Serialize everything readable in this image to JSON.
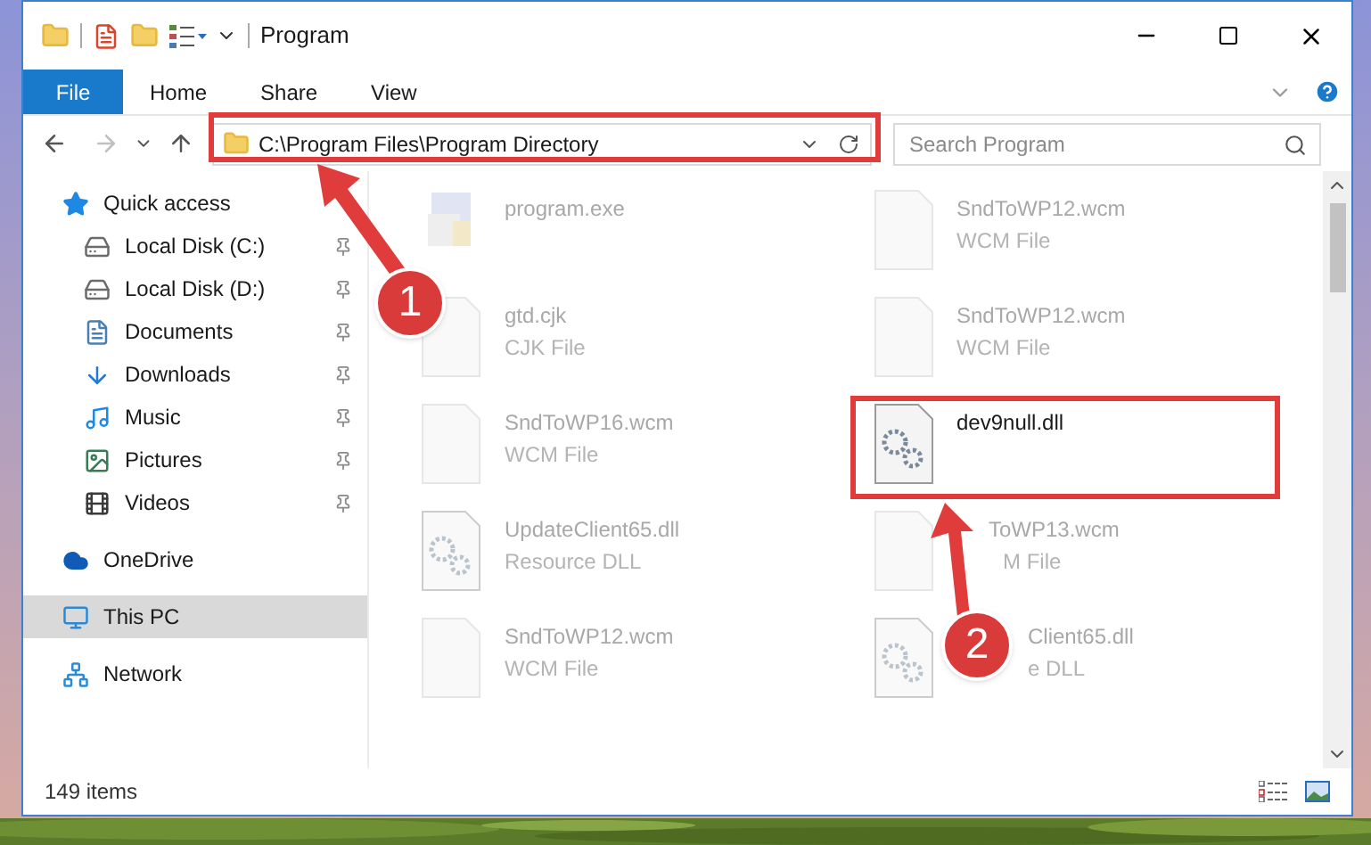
{
  "window": {
    "title": "Program"
  },
  "ribbon_tabs": [
    {
      "label": "File",
      "kind": "menu"
    },
    {
      "label": "Home",
      "kind": "tab"
    },
    {
      "label": "Share",
      "kind": "tab"
    },
    {
      "label": "View",
      "kind": "tab"
    }
  ],
  "address_bar": {
    "path": "C:\\Program Files\\Program Directory"
  },
  "search": {
    "placeholder": "Search Program"
  },
  "sidebar": [
    {
      "label": "Quick access",
      "kind": "star",
      "selected": false,
      "children": [
        {
          "label": "Local Disk (C:)",
          "kind": "drive",
          "pinned": true,
          "selected": false
        },
        {
          "label": "Local Disk (D:)",
          "kind": "drive",
          "pinned": true,
          "selected": false
        },
        {
          "label": "Documents",
          "kind": "documents",
          "pinned": true,
          "selected": false
        },
        {
          "label": "Downloads",
          "kind": "downloads",
          "pinned": true,
          "selected": false
        },
        {
          "label": "Music",
          "kind": "music",
          "pinned": true,
          "selected": false
        },
        {
          "label": "Pictures",
          "kind": "pictures",
          "pinned": true,
          "selected": false
        },
        {
          "label": "Videos",
          "kind": "videos",
          "pinned": true,
          "selected": false
        }
      ]
    },
    {
      "label": "OneDrive",
      "kind": "cloud",
      "selected": false
    },
    {
      "label": "This PC",
      "kind": "pc",
      "selected": true
    },
    {
      "label": "Network",
      "kind": "network",
      "selected": false
    }
  ],
  "files": [
    {
      "name": "program.exe",
      "kind": "exe",
      "dimmed": true
    },
    {
      "name": "SndToWP12.wcm",
      "type": "WCM File",
      "kind": "blank",
      "dimmed": true
    },
    {
      "name": "gtd.cjk",
      "type": "CJK File",
      "kind": "blank",
      "dimmed": true
    },
    {
      "name": "SndToWP12.wcm",
      "type": "WCM File",
      "kind": "blank",
      "dimmed": true
    },
    {
      "name": "SndToWP16.wcm",
      "type": "WCM File",
      "kind": "blank",
      "dimmed": true
    },
    {
      "name": "dev9null.dll",
      "kind": "gear",
      "dimmed": false
    },
    {
      "name": "UpdateClient65.dll",
      "type": "Resource DLL",
      "kind": "gear",
      "dimmed": true
    },
    {
      "name": "ToWP13.wcm",
      "type": "M File",
      "kind": "blank",
      "dimmed": true
    },
    {
      "name": "SndToWP12.wcm",
      "type": "WCM File",
      "kind": "blank",
      "dimmed": true
    },
    {
      "name": "Client65.dll",
      "type": "e DLL",
      "kind": "gear",
      "dimmed": true
    }
  ],
  "status_bar": {
    "count": "149 items"
  },
  "annotations": [
    {
      "number": "1"
    },
    {
      "number": "2"
    }
  ]
}
